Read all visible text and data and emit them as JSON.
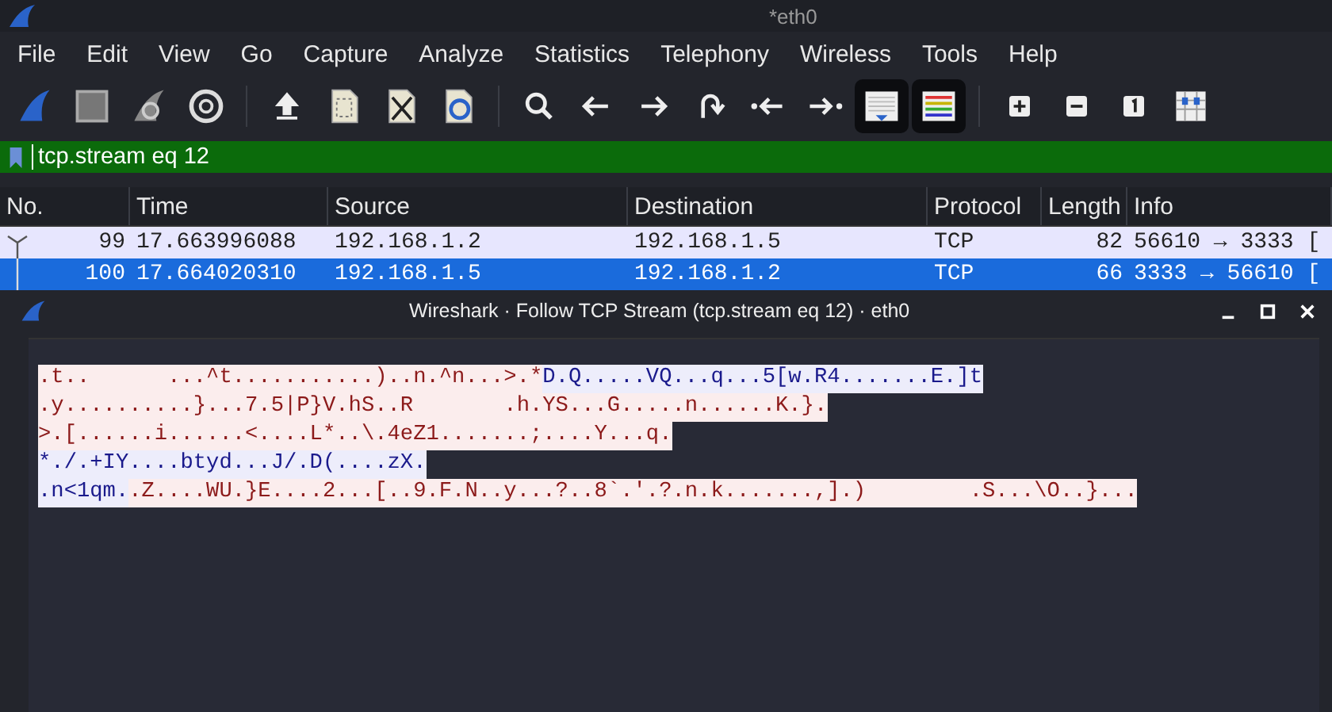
{
  "window": {
    "title": "*eth0"
  },
  "menu": [
    "File",
    "Edit",
    "View",
    "Go",
    "Capture",
    "Analyze",
    "Statistics",
    "Telephony",
    "Wireless",
    "Tools",
    "Help"
  ],
  "toolbar": [
    {
      "on": false
    },
    {
      "on": false
    },
    {
      "on": false
    },
    {
      "on": false
    },
    {
      "on": false
    },
    {
      "on": false
    },
    {
      "on": false
    },
    {
      "on": false
    },
    {
      "on": false
    },
    {
      "on": false
    },
    {
      "on": false
    },
    {
      "on": false
    },
    {
      "on": false
    },
    {
      "on": false
    },
    {
      "on": true
    },
    {
      "on": true
    },
    {
      "on": false
    },
    {
      "on": false
    },
    {
      "on": false
    },
    {
      "on": false
    }
  ],
  "filter": {
    "value": "tcp.stream eq 12"
  },
  "table": {
    "columns": [
      "No.",
      "Time",
      "Source",
      "Destination",
      "Protocol",
      "Length",
      "Info"
    ],
    "rows": [
      {
        "selected": false,
        "cells": [
          "99",
          "17.663996088",
          "192.168.1.2",
          "192.168.1.5",
          "TCP",
          "82",
          "56610 → 3333 ["
        ]
      },
      {
        "selected": true,
        "cells": [
          "100",
          "17.664020310",
          "192.168.1.5",
          "192.168.1.2",
          "TCP",
          "66",
          "3333 → 56610 ["
        ]
      }
    ]
  },
  "dialog": {
    "title": "Wireshark · Follow TCP Stream (tcp.stream eq 12) · eth0",
    "lines": [
      [
        {
          "kind": "server",
          "text": ".t..      ...^t...........)..n.^n...>.*"
        },
        {
          "kind": "client",
          "text": "D.Q.....VQ...q...5[w.R4.......E.]t"
        }
      ],
      [
        {
          "kind": "server",
          "text": ".y..........}...7.5|P}V.hS..R       .h.YS...G.....n......K.}."
        }
      ],
      [
        {
          "kind": "server",
          "text": ">.[......i......<....L*..\\.4eZ1.......;....Y...q."
        }
      ],
      [
        {
          "kind": "client",
          "text": "*./.+IY....btyd...J/.D(....zX."
        }
      ],
      [
        {
          "kind": "client",
          "text": ".n<1qm."
        },
        {
          "kind": "server",
          "text": ".Z....WU.}E....2...[..9.F.N..y...?..8`.'.?.n.k.......,].)        .S...\\O..}..."
        }
      ]
    ]
  }
}
